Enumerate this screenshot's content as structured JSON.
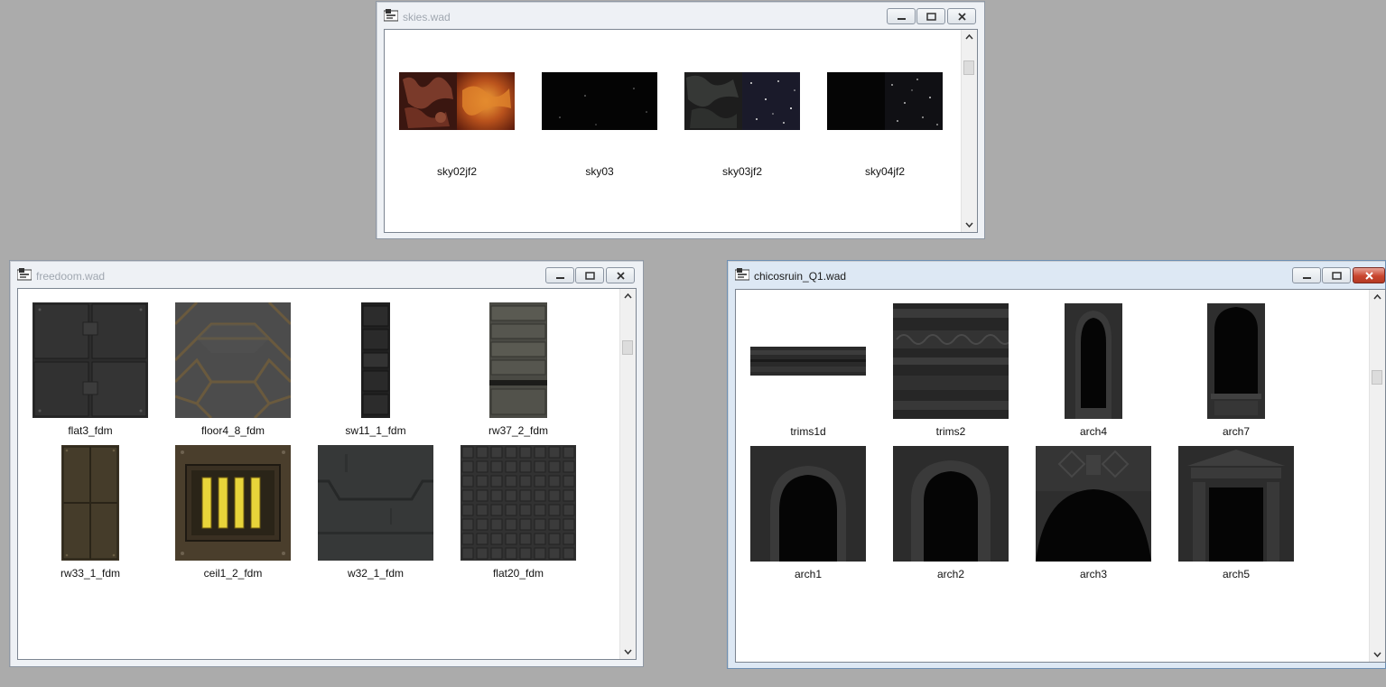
{
  "windows": {
    "skies": {
      "title": "skies.wad",
      "textures": [
        {
          "name": "sky02jf2",
          "icon": "fiery-sky-texture"
        },
        {
          "name": "sky03",
          "icon": "black-starfield-texture"
        },
        {
          "name": "sky03jf2",
          "icon": "dark-cloud-starfield-texture"
        },
        {
          "name": "sky04jf2",
          "icon": "black-starfield-texture"
        }
      ]
    },
    "freedoom": {
      "title": "freedoom.wad",
      "textures": [
        {
          "name": "flat3_fdm",
          "icon": "metal-plate-texture"
        },
        {
          "name": "floor4_8_fdm",
          "icon": "hexagon-floor-texture"
        },
        {
          "name": "sw11_1_fdm",
          "icon": "narrow-metal-strip-texture"
        },
        {
          "name": "rw37_2_fdm",
          "icon": "ribbed-panel-texture"
        },
        {
          "name": "rw33_1_fdm",
          "icon": "cross-panel-texture"
        },
        {
          "name": "ceil1_2_fdm",
          "icon": "yellow-light-bars-texture"
        },
        {
          "name": "w32_1_fdm",
          "icon": "dark-wall-texture"
        },
        {
          "name": "flat20_fdm",
          "icon": "grid-tile-texture"
        }
      ]
    },
    "chicosruin": {
      "title": "chicosruin_Q1.wad",
      "textures": [
        {
          "name": "trims1d",
          "icon": "stone-trim-texture"
        },
        {
          "name": "trims2",
          "icon": "ornate-trim-texture"
        },
        {
          "name": "arch4",
          "icon": "narrow-arch-texture"
        },
        {
          "name": "arch7",
          "icon": "arched-window-texture"
        },
        {
          "name": "arch1",
          "icon": "stone-arch-texture"
        },
        {
          "name": "arch2",
          "icon": "stone-arch-texture"
        },
        {
          "name": "arch3",
          "icon": "wide-arch-texture"
        },
        {
          "name": "arch5",
          "icon": "doorway-texture"
        }
      ]
    }
  },
  "colors": {
    "desktop": "#ababab",
    "close_active": "#c9462f",
    "highlight_yellow": "#e8d43a"
  }
}
